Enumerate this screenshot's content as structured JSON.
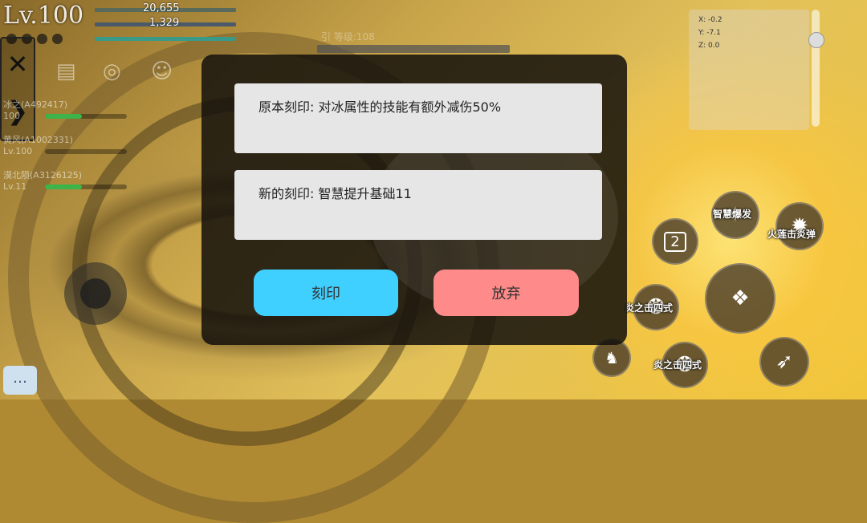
{
  "hud": {
    "level": "Lv.100",
    "hp_value": "20,655",
    "mp_value": "1,329"
  },
  "side_panel": {
    "close_icon": "close-icon",
    "expand_icon": "chevron-right-icon"
  },
  "party": [
    {
      "name": "冰之(A492417)",
      "level": "100",
      "hp": 0.45
    },
    {
      "name": "黄风(A1002331)",
      "level": "Lv.100",
      "hp": 0.0
    },
    {
      "name": "漠北陨(A3126125)",
      "level": "Lv.11",
      "hp": 0.45
    }
  ],
  "boss": {
    "name": "引 等级:108"
  },
  "minimap": {
    "x": "X: -0.2",
    "y": "Y: -7.1",
    "z": "Z: 0.0"
  },
  "skills": {
    "wisdom_burst": "智慧爆发",
    "fire_lotus": "火莲击炎弹",
    "flame_strike_a": "炎之击四式",
    "flame_strike_b": "炎之击四式",
    "potion_count": "2"
  },
  "dialog": {
    "original_engraving": "原本刻印: 对冰属性的技能有额外减伤50%",
    "new_engraving": "新的刻印: 智慧提升基础11",
    "engrave_button": "刻印",
    "abandon_button": "放弃"
  },
  "colors": {
    "engrave_button": "#3fd0ff",
    "abandon_button": "#ff8a8a",
    "hp_bar": "#3cb44a"
  }
}
